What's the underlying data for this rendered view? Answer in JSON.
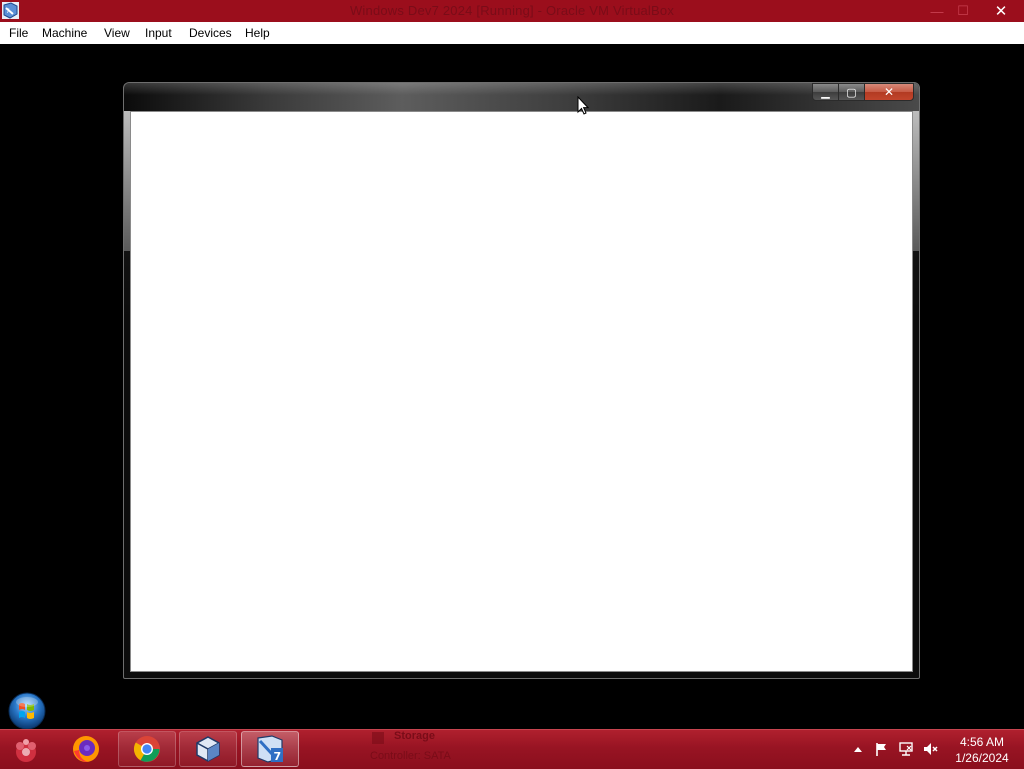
{
  "host": {
    "title": "Windows Dev7 2024 [Running] - Oracle VM VirtualBox",
    "controls": {
      "minimize": "—",
      "maximize": "☐",
      "close": "✕"
    }
  },
  "menubar": {
    "items": [
      "File",
      "Machine",
      "View",
      "Input",
      "Devices",
      "Help"
    ]
  },
  "guest_window": {
    "controls": {
      "minimize": "▁",
      "maximize": "▢",
      "close": "✕"
    }
  },
  "taskbar": {
    "pinned": [
      {
        "name": "Firefox",
        "icon": "firefox-icon"
      },
      {
        "name": "Google Chrome",
        "icon": "chrome-icon"
      },
      {
        "name": "VirtualBox",
        "icon": "virtualbox-icon"
      },
      {
        "name": "Windows 7 VM",
        "icon": "windows7-vm-icon"
      }
    ],
    "ghost": {
      "title": "Storage",
      "subtitle": "Controller: SATA"
    },
    "clock": {
      "time": "4:56 AM",
      "date": "1/26/2024"
    }
  },
  "colors": {
    "host_titlebar": "#9b0e1c",
    "taskbar": "#981423",
    "desktop": "#000000",
    "guest_client": "#ffffff"
  }
}
